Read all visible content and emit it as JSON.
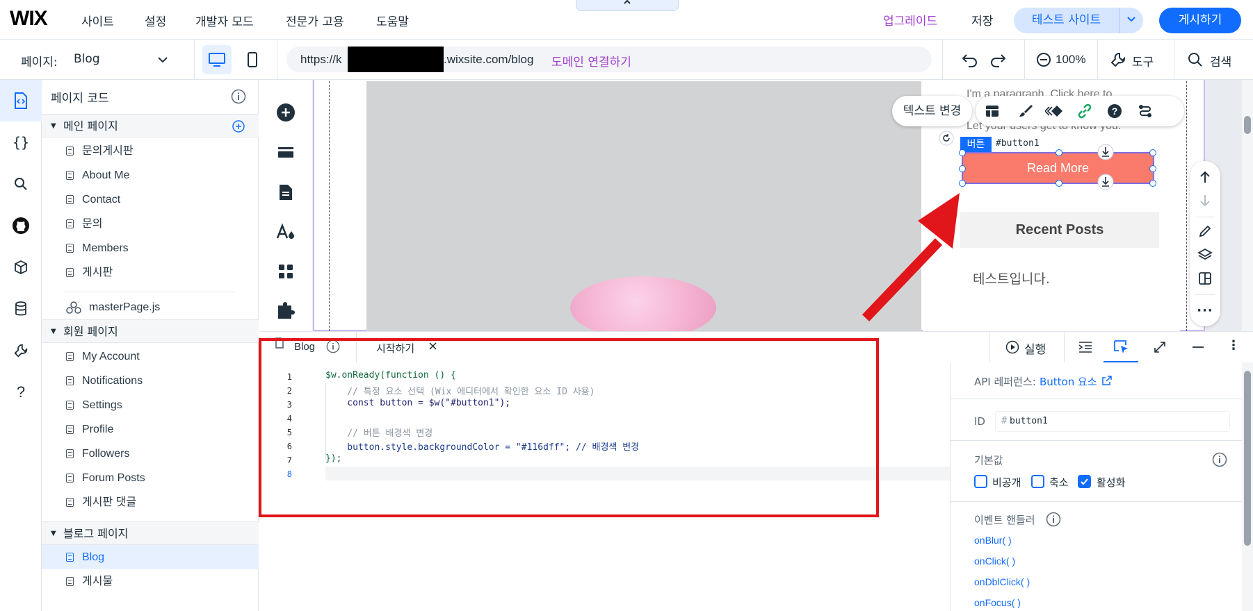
{
  "topbar": {
    "logo": "WIX",
    "menu": [
      "사이트",
      "설정",
      "개발자 모드",
      "전문가 고용",
      "도움말"
    ],
    "upgrade": "업그레이드",
    "save": "저장",
    "test_site": "테스트 사이트",
    "publish": "게시하기",
    "collapse_tab_icon": "chevron-up-icon"
  },
  "bar2": {
    "page_label": "페이지:",
    "page_value": "Blog",
    "url_prefix": "https://k",
    "url_suffix": ".wixsite.com/blog",
    "connect_domain": "도메인 연결하기",
    "zoom": "100%",
    "tools": "도구",
    "search": "검색"
  },
  "panel": {
    "title": "페이지 코드",
    "sections": [
      {
        "title": "메인 페이지",
        "items": [
          "문의게시판",
          "About Me",
          "Contact",
          "문의",
          "Members",
          "게시판"
        ]
      },
      {
        "title": "회원 페이지",
        "items": [
          "My Account",
          "Notifications",
          "Settings",
          "Profile",
          "Followers",
          "Forum Posts",
          "게시판 댓글"
        ]
      },
      {
        "title": "블로그 페이지",
        "items": [
          "Blog",
          "게시물"
        ]
      }
    ],
    "master_page": "masterPage.js",
    "selected_item": "Blog"
  },
  "canvas": {
    "paragraph_lines": [
      "I'm a paragraph. Click here to",
      "Let your users get to know you."
    ],
    "button_tag": "버튼",
    "button_id": "#button1",
    "button_label": "Read More",
    "recent_posts": "Recent Posts",
    "post_text": "테스트입니다.",
    "text_change": "텍스트 변경"
  },
  "code_editor": {
    "tabs": [
      {
        "label": "Blog"
      },
      {
        "label": "시작하기"
      }
    ],
    "run": "실행",
    "line_numbers": [
      "1",
      "2",
      "3",
      "4",
      "5",
      "6",
      "7",
      "8"
    ],
    "lines": [
      "$w.onReady(function () {",
      "    // 특정 요소 선택 (Wix 에디터에서 확인한 요소 ID 사용)",
      "    const button = $w(\"#button1\");",
      "",
      "    // 버튼 배경색 변경",
      "    button.style.backgroundColor = \"#116dff\"; // 배경색 변경",
      "});",
      ""
    ]
  },
  "properties": {
    "api_ref_label": "API 레퍼런스:",
    "api_ref_link": "Button 요소",
    "id_label": "ID",
    "id_hash": "#",
    "id_value": "button1",
    "defaults_label": "기본값",
    "checkboxes": [
      {
        "label": "비공개",
        "checked": false
      },
      {
        "label": "축소",
        "checked": false
      },
      {
        "label": "활성화",
        "checked": true
      }
    ],
    "event_handlers_label": "이벤트 핸들러",
    "handlers": [
      "onBlur( )",
      "onClick( )",
      "onDblClick( )",
      "onFocus( )"
    ]
  },
  "colors": {
    "accent": "#116dff",
    "upgrade": "#a33ed0",
    "button_bg": "#fa7a6c",
    "annotation_red": "#e1161a"
  }
}
